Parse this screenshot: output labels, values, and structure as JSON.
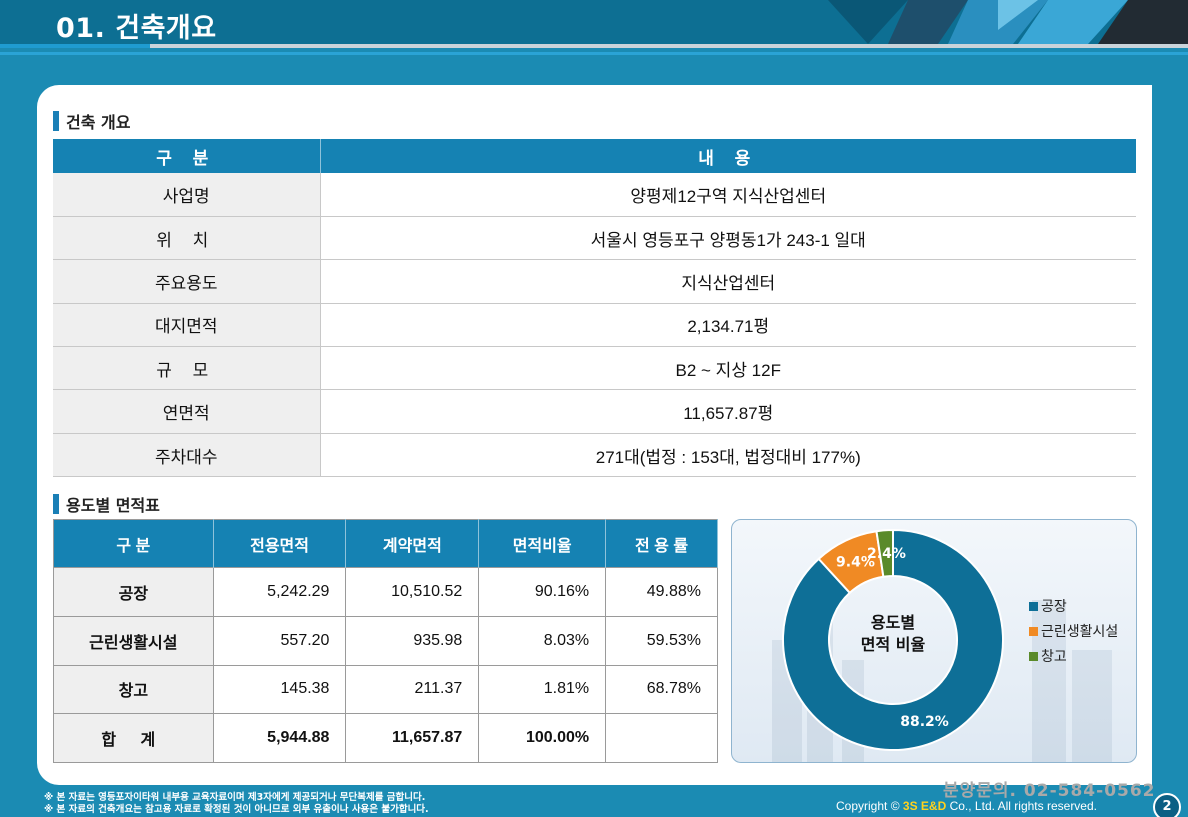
{
  "header": {
    "title": "01. 건축개요"
  },
  "overview": {
    "section_title": "건축 개요",
    "col_headers": [
      "구 분",
      "내 용"
    ],
    "rows": [
      {
        "label": "사업명",
        "value": "양평제12구역 지식산업센터"
      },
      {
        "label": "위 치",
        "value": "서울시 영등포구 양평동1가 243-1 일대"
      },
      {
        "label": "주요용도",
        "value": "지식산업센터"
      },
      {
        "label": "대지면적",
        "value": "2,134.71평"
      },
      {
        "label": "규 모",
        "value": "B2 ~ 지상 12F"
      },
      {
        "label": "연면적",
        "value": "11,657.87평"
      },
      {
        "label": "주차대수",
        "value": "271대(법정 : 153대, 법정대비 177%)"
      }
    ]
  },
  "area_table": {
    "section_title": "용도별 면적표",
    "col_headers": [
      "구 분",
      "전용면적",
      "계약면적",
      "면적비율",
      "전 용 률"
    ],
    "rows": [
      {
        "label": "공장",
        "cells": [
          "5,242.29",
          "10,510.52",
          "90.16%",
          "49.88%"
        ]
      },
      {
        "label": "근린생활시설",
        "cells": [
          "557.20",
          "935.98",
          "8.03%",
          "59.53%"
        ]
      },
      {
        "label": "창고",
        "cells": [
          "145.38",
          "211.37",
          "1.81%",
          "68.78%"
        ]
      },
      {
        "label": "합 계",
        "cells": [
          "5,944.88",
          "11,657.87",
          "100.00%",
          ""
        ]
      }
    ]
  },
  "chart_data": {
    "type": "pie",
    "title": "용도별 면적 비율",
    "categories": [
      "공장",
      "근린생활시설",
      "창고"
    ],
    "values": [
      88.2,
      9.4,
      2.4
    ],
    "labels": [
      "88.2%",
      "9.4%",
      "2.4%"
    ],
    "colors": [
      "#0e6f97",
      "#f08a24",
      "#5a8a2a"
    ],
    "legend_position": "right"
  },
  "footer": {
    "notes": [
      "※ 본 자료는 영등포자이타워 내부용 교육자료이며 제3자에게 제공되거나 무단복제를 금합니다.",
      "※ 본 자료의 건축개요는 참고용 자료로 확정된 것이 아니므로 외부 유출이나 사용은 불가합니다."
    ],
    "contact": "분양문의. 02-584-0562",
    "copyright_prefix": "Copyright ©",
    "copyright_brand": "3S E&D",
    "copyright_suffix": "Co., Ltd. All rights reserved.",
    "page_number": "2"
  }
}
